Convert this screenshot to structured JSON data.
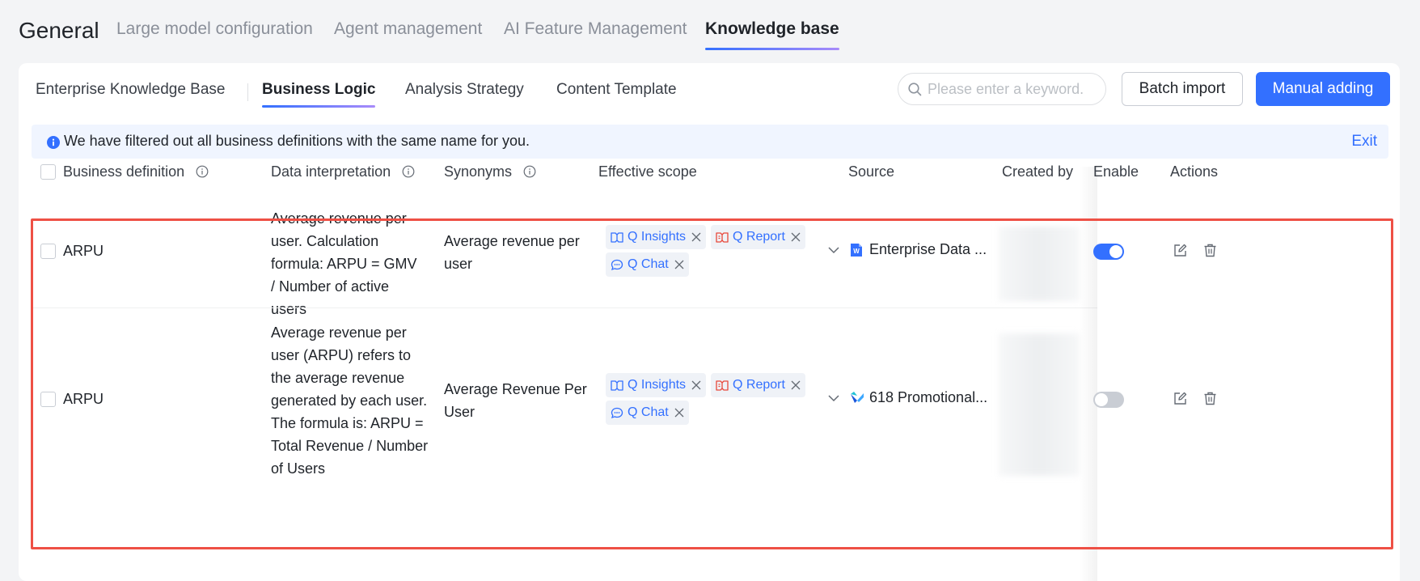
{
  "top_tabs": {
    "general": "General",
    "large_model": "Large model configuration",
    "agent": "Agent management",
    "ai_feature": "AI Feature Management",
    "knowledge_base": "Knowledge base"
  },
  "sub_tabs": {
    "enterprise": "Enterprise Knowledge Base",
    "business_logic": "Business Logic",
    "analysis": "Analysis Strategy",
    "content": "Content Template"
  },
  "toolbar": {
    "search_placeholder": "Please enter a keyword.",
    "batch_import": "Batch import",
    "manual_adding": "Manual adding"
  },
  "banner": {
    "text": "We have filtered out all business definitions with the same name for you.",
    "exit": "Exit"
  },
  "table": {
    "headers": {
      "business_definition": "Business definition",
      "data_interpretation": "Data interpretation",
      "synonyms": "Synonyms",
      "effective_scope": "Effective scope",
      "source": "Source",
      "created_by": "Created by",
      "enable": "Enable",
      "actions": "Actions"
    },
    "rows": [
      {
        "definition": "ARPU",
        "interpretation": "Average revenue per user. Calculation formula: ARPU = GMV / Number of active users",
        "synonyms": "Average revenue per user",
        "scope": [
          "Q Insights",
          "Q Report",
          "Q Chat"
        ],
        "source": "Enterprise Data ...",
        "enabled": true
      },
      {
        "definition": "ARPU",
        "interpretation": "Average revenue per user (ARPU) refers to the average revenue generated by each user. The formula is: ARPU = Total Revenue / Number of Users",
        "synonyms": "Average Revenue Per User",
        "scope": [
          "Q Insights",
          "Q Report",
          "Q Chat"
        ],
        "source": "618 Promotional...",
        "enabled": false
      }
    ]
  },
  "colors": {
    "accent": "#3370ff",
    "highlight": "#ee5045",
    "report_icon": "#e8483b"
  },
  "icons": [
    "search-icon",
    "info-icon",
    "insights-icon",
    "report-icon",
    "chat-icon",
    "close-icon",
    "chevron-down-icon",
    "word-doc-icon",
    "dataset-icon",
    "edit-icon",
    "delete-icon"
  ]
}
